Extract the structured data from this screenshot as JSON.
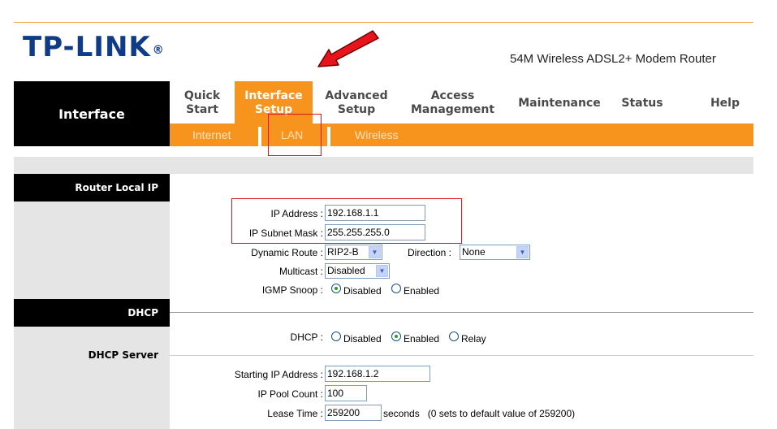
{
  "brand": {
    "logo_text": "TP-LINK",
    "logo_mark": "®",
    "product_name": "54M Wireless ADSL2+ Modem Router"
  },
  "section_title": "Interface",
  "menu": {
    "tabs": [
      {
        "label": "Quick Start"
      },
      {
        "label": "Interface Setup"
      },
      {
        "label": "Advanced Setup"
      },
      {
        "label": "Access Management"
      },
      {
        "label": "Maintenance"
      },
      {
        "label": "Status"
      },
      {
        "label": "Help"
      }
    ],
    "active_tab": "Interface Setup"
  },
  "submenu": {
    "items": [
      {
        "label": "Internet"
      },
      {
        "label": "LAN"
      },
      {
        "label": "Wireless"
      }
    ],
    "active": "LAN"
  },
  "router_local_ip": {
    "heading": "Router Local IP",
    "ip_address_label": "IP Address :",
    "ip_address_value": "192.168.1.1",
    "subnet_mask_label": "IP Subnet Mask :",
    "subnet_mask_value": "255.255.255.0",
    "dynamic_route_label": "Dynamic Route :",
    "dynamic_route_value": "RIP2-B",
    "direction_label": "Direction :",
    "direction_value": "None",
    "multicast_label": "Multicast :",
    "multicast_value": "Disabled",
    "igmp_snoop_label": "IGMP Snoop :",
    "igmp_snoop_options": [
      "Disabled",
      "Enabled"
    ],
    "igmp_snoop_selected": "Disabled"
  },
  "dhcp": {
    "heading": "DHCP",
    "dhcp_label": "DHCP :",
    "dhcp_options": [
      "Disabled",
      "Enabled",
      "Relay"
    ],
    "dhcp_selected": "Enabled",
    "server_heading": "DHCP Server",
    "starting_ip_label": "Starting IP Address :",
    "starting_ip_value": "192.168.1.2",
    "pool_count_label": "IP Pool Count :",
    "pool_count_value": "100",
    "lease_time_label": "Lease Time :",
    "lease_time_value": "259200",
    "lease_time_hint": "seconds   (0 sets to default value of 259200)"
  },
  "colors": {
    "accent_orange": "#f7941d",
    "logo_blue": "#0f3b87",
    "highlight_red": "#e0121b",
    "panel_gray": "#e5e5e5"
  },
  "annotations": {
    "arrow_icon": "red-arrow-icon"
  }
}
